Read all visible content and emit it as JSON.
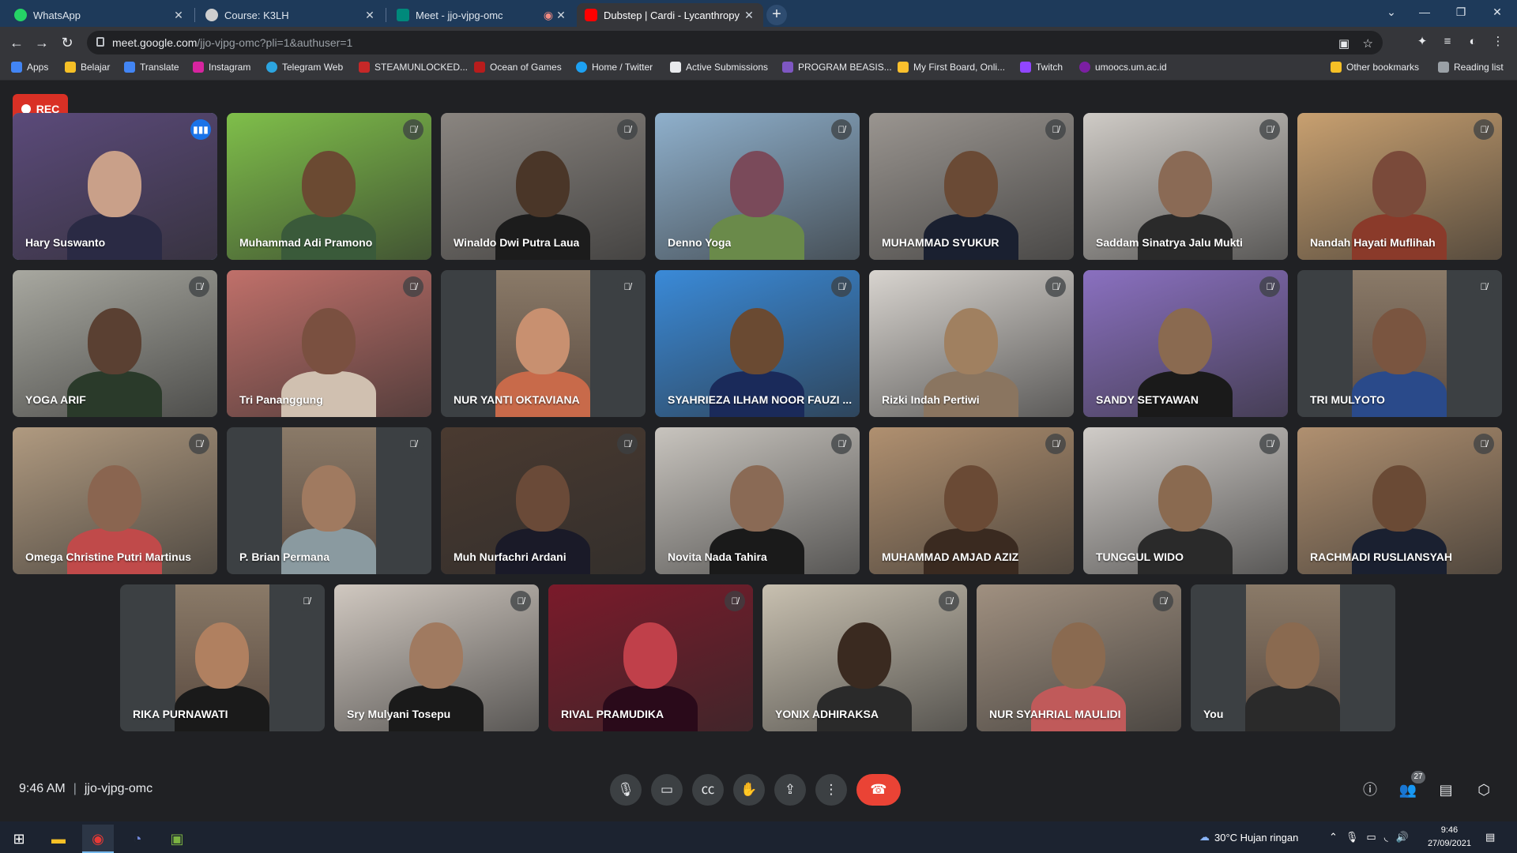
{
  "browser": {
    "tabs": [
      {
        "title": "WhatsApp",
        "icon": "whatsapp-icon",
        "color": "#25d366"
      },
      {
        "title": "Course: K3LH",
        "icon": "moodle-icon",
        "color": "#cfcfcf"
      },
      {
        "title": "Meet - jjo-vjpg-omc",
        "icon": "meet-icon",
        "color": "#00897b"
      },
      {
        "title": "Dubstep | Cardi - Lycanthropy - Y",
        "icon": "youtube-icon",
        "color": "#ff0000"
      }
    ],
    "new_tab": "+",
    "url_host": "meet.google.com",
    "url_path": "/jjo-vjpg-omc?pli=1&authuser=1",
    "bookmarks": [
      {
        "label": "Apps",
        "color": "#4285f4"
      },
      {
        "label": "Belajar",
        "color": "#f6c026"
      },
      {
        "label": "Translate",
        "color": "#4285f4"
      },
      {
        "label": "Instagram",
        "color": "#d6249f"
      },
      {
        "label": "Telegram Web",
        "color": "#2ca5e0"
      },
      {
        "label": "STEAMUNLOCKED...",
        "color": "#c62828"
      },
      {
        "label": "Ocean of Games",
        "color": "#b71c1c"
      },
      {
        "label": "Home / Twitter",
        "color": "#1da1f2"
      },
      {
        "label": "Active Submissions",
        "color": "#e8eaed"
      },
      {
        "label": "PROGRAM BEASIS...",
        "color": "#7e57c2"
      },
      {
        "label": "My First Board, Onli...",
        "color": "#fbc02d"
      },
      {
        "label": "Twitch",
        "color": "#9146ff"
      },
      {
        "label": "umoocs.um.ac.id",
        "color": "#7b1fa2"
      }
    ],
    "other_bookmarks": "Other bookmarks",
    "reading_list": "Reading list"
  },
  "meet": {
    "rec_label": "REC",
    "time": "9:46 AM",
    "meeting_code": "jjo-vjpg-omc",
    "participants_count": "27",
    "participants": [
      {
        "name": "Hary Suswanto",
        "bg": "#5b4a7a",
        "skin": "#c9a089",
        "shirt": "#2a2a44",
        "speaking": true
      },
      {
        "name": "Muhammad Adi Pramono",
        "bg": "#7fbf4a",
        "skin": "#6b4a32",
        "shirt": "#3a5a3a"
      },
      {
        "name": "Winaldo Dwi Putra Laua",
        "bg": "#8a8580",
        "skin": "#4a3628",
        "shirt": "#1c1c1c"
      },
      {
        "name": "Denno Yoga",
        "bg": "#8fb0cc",
        "skin": "#7a4a5a",
        "shirt": "#6a8a4a"
      },
      {
        "name": "MUHAMMAD SYUKUR",
        "bg": "#9a9590",
        "skin": "#6a4a35",
        "shirt": "#1a2030"
      },
      {
        "name": "Saddam Sinatrya Jalu Mukti",
        "bg": "#cfcbc6",
        "skin": "#8a6a55",
        "shirt": "#2a2a2a"
      },
      {
        "name": "Nandah Hayati Muflihah",
        "bg": "#c8a070",
        "skin": "#7a4a3a",
        "shirt": "#8a3a2a"
      },
      {
        "name": "YOGA ARIF",
        "bg": "#a8a8a0",
        "skin": "#5a4032",
        "shirt": "#2a3a2a"
      },
      {
        "name": "Tri Pananggung",
        "bg": "#c0706a",
        "skin": "#7a5040",
        "shirt": "#d0c0b0"
      },
      {
        "name": "NUR YANTI OKTAVIANA",
        "bg": "#3c4043",
        "skin": "#c89070",
        "shirt": "#c86a4a"
      },
      {
        "name": "SYAHRIEZA ILHAM NOOR FAUZI ...",
        "bg": "#3a8ad8",
        "skin": "#6a4a32",
        "shirt": "#1a2a5a"
      },
      {
        "name": "Rizki Indah Pertiwi",
        "bg": "#d8d4cf",
        "skin": "#a08060",
        "shirt": "#8a7560"
      },
      {
        "name": "SANDY SETYAWAN",
        "bg": "#8a70c0",
        "skin": "#8a6a50",
        "shirt": "#1a1a1a"
      },
      {
        "name": "TRI MULYOTO",
        "bg": "#3c4043",
        "skin": "#7a5540",
        "shirt": "#2a4a8a"
      },
      {
        "name": "Omega Christine Putri Martinus",
        "bg": "#b09a80",
        "skin": "#8a6550",
        "shirt": "#c04a4a"
      },
      {
        "name": "P. Brian Permana",
        "bg": "#3c4043",
        "skin": "#a07a60",
        "shirt": "#8a9aa0"
      },
      {
        "name": "Muh Nurfachri Ardani",
        "bg": "#4a3a30",
        "skin": "#6a4a38",
        "shirt": "#1a1a28"
      },
      {
        "name": "Novita Nada Tahira",
        "bg": "#c8c4be",
        "skin": "#8a6a55",
        "shirt": "#1a1a1a"
      },
      {
        "name": "MUHAMMAD AMJAD AZIZ",
        "bg": "#b09070",
        "skin": "#6a4a35",
        "shirt": "#3a2a20"
      },
      {
        "name": "TUNGGUL WIDO",
        "bg": "#d0ccc8",
        "skin": "#8a6a50",
        "shirt": "#2a2a2a"
      },
      {
        "name": "RACHMADI RUSLIANSYAH",
        "bg": "#b09070",
        "skin": "#6a4a35",
        "shirt": "#1a2030"
      },
      {
        "name": "RIKA PURNAWATI",
        "bg": "#3c4043",
        "skin": "#b08060",
        "shirt": "#1a1a1a"
      },
      {
        "name": "Sry Mulyani Tosepu",
        "bg": "#d0c8c0",
        "skin": "#a07a60",
        "shirt": "#1a1a1a"
      },
      {
        "name": "RIVAL PRAMUDIKA",
        "bg": "#7a1a2a",
        "skin": "#c0404a",
        "shirt": "#2a0a1a"
      },
      {
        "name": "YONIX ADHIRAKSA",
        "bg": "#c8c0b0",
        "skin": "#3a2a20",
        "shirt": "#2a2a2a"
      },
      {
        "name": "NUR SYAHRIAL MAULIDI",
        "bg": "#a09080",
        "skin": "#8a6a50",
        "shirt": "#c05a5a"
      },
      {
        "name": "You",
        "bg": "#3c4043",
        "skin": "#8a6a50",
        "shirt": "#2a2a2a"
      }
    ]
  },
  "taskbar": {
    "weather": "30°C  Hujan ringan",
    "time": "9:46",
    "date": "27/09/2021"
  }
}
